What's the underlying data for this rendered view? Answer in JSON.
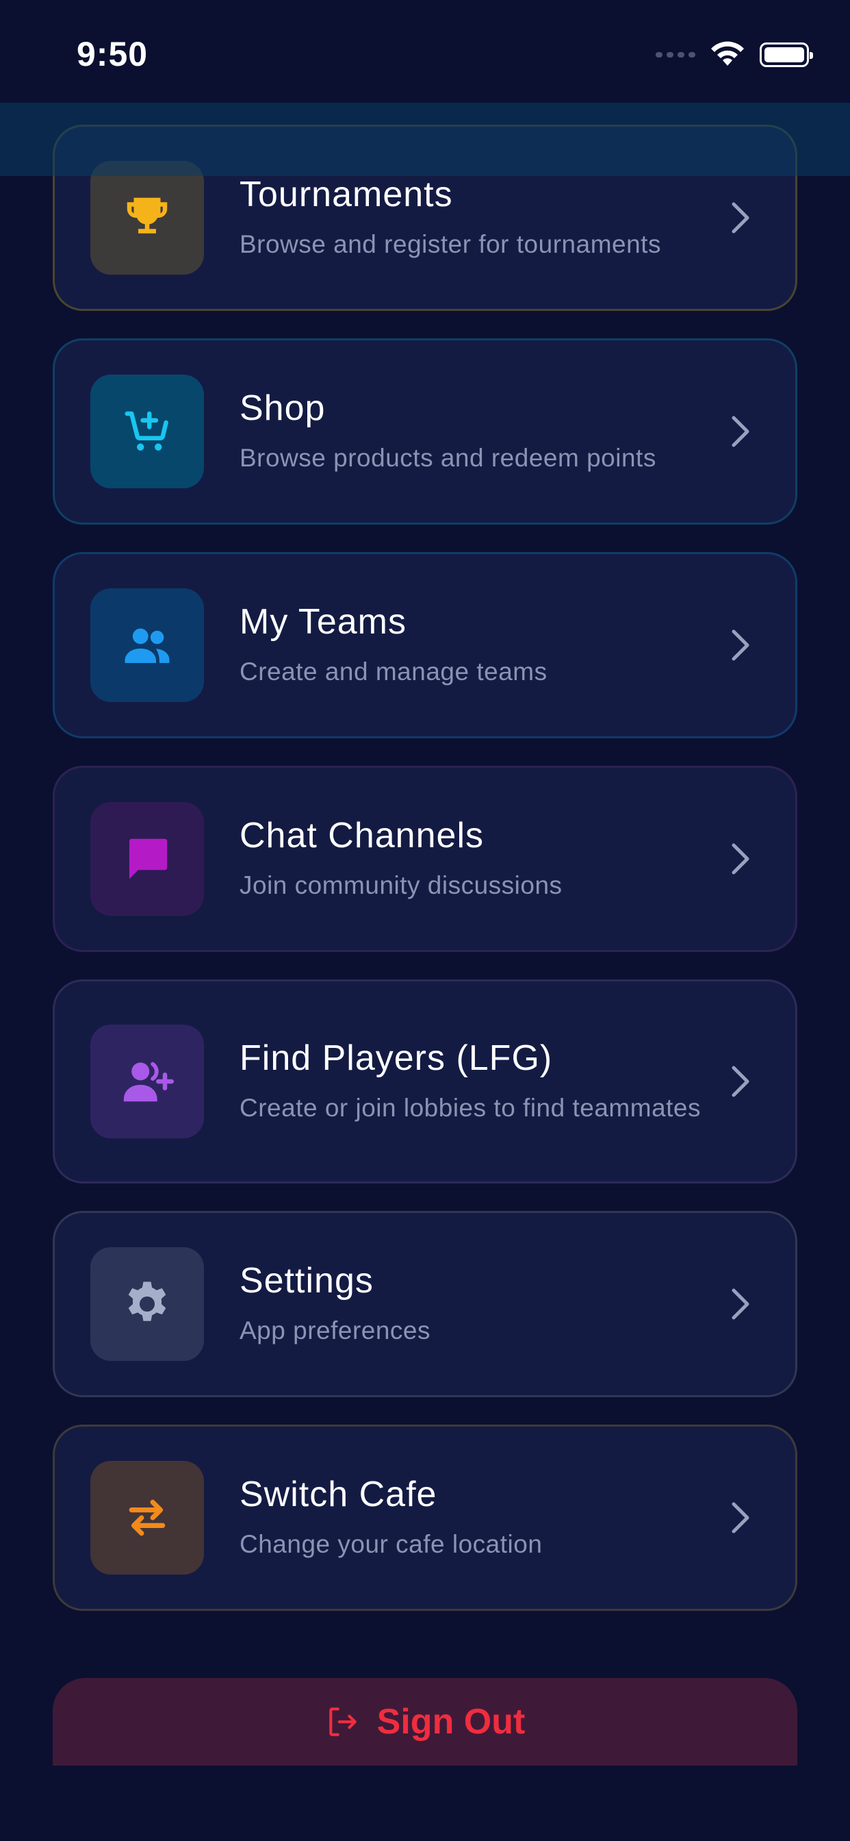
{
  "status_bar": {
    "time": "9:50"
  },
  "colors": {
    "background": "#0b1030",
    "card": "#141b43",
    "title": "#ffffff",
    "subtitle": "#8c93b3",
    "signout_text": "#ef2d3f",
    "signout_bg": "#3e1a38"
  },
  "menu": {
    "items": [
      {
        "title": "Tournaments",
        "subtitle": "Browse and register for tournaments",
        "icon": "trophy-icon",
        "accent": "#f5b31a",
        "icon_bg": "#3d3a3a",
        "border": "#4a4530"
      },
      {
        "title": "Shop",
        "subtitle": "Browse products and redeem points",
        "icon": "cart-plus-icon",
        "accent": "#19c6ee",
        "icon_bg": "#07476c",
        "border": "#0f3f66"
      },
      {
        "title": "My Teams",
        "subtitle": "Create and manage teams",
        "icon": "people-icon",
        "accent": "#1e9bf0",
        "icon_bg": "#0b3a6a",
        "border": "#103b6b"
      },
      {
        "title": "Chat Channels",
        "subtitle": "Join community discussions",
        "icon": "chat-bubble-icon",
        "accent": "#b41bc6",
        "icon_bg": "#2e1b54",
        "border": "#2e2154"
      },
      {
        "title": "Find Players (LFG)",
        "subtitle": "Create or join lobbies to find teammates",
        "icon": "person-add-icon",
        "accent": "#a959e8",
        "icon_bg": "#2f2462",
        "border": "#2e2a5a"
      },
      {
        "title": "Settings",
        "subtitle": "App preferences",
        "icon": "gear-icon",
        "accent": "#a6aec9",
        "icon_bg": "#2c3557",
        "border": "#303754"
      },
      {
        "title": "Switch Cafe",
        "subtitle": "Change your cafe location",
        "icon": "swap-arrows-icon",
        "accent": "#f28a1c",
        "icon_bg": "#433436",
        "border": "#3e3a3a"
      }
    ]
  },
  "sign_out": {
    "label": "Sign Out"
  }
}
